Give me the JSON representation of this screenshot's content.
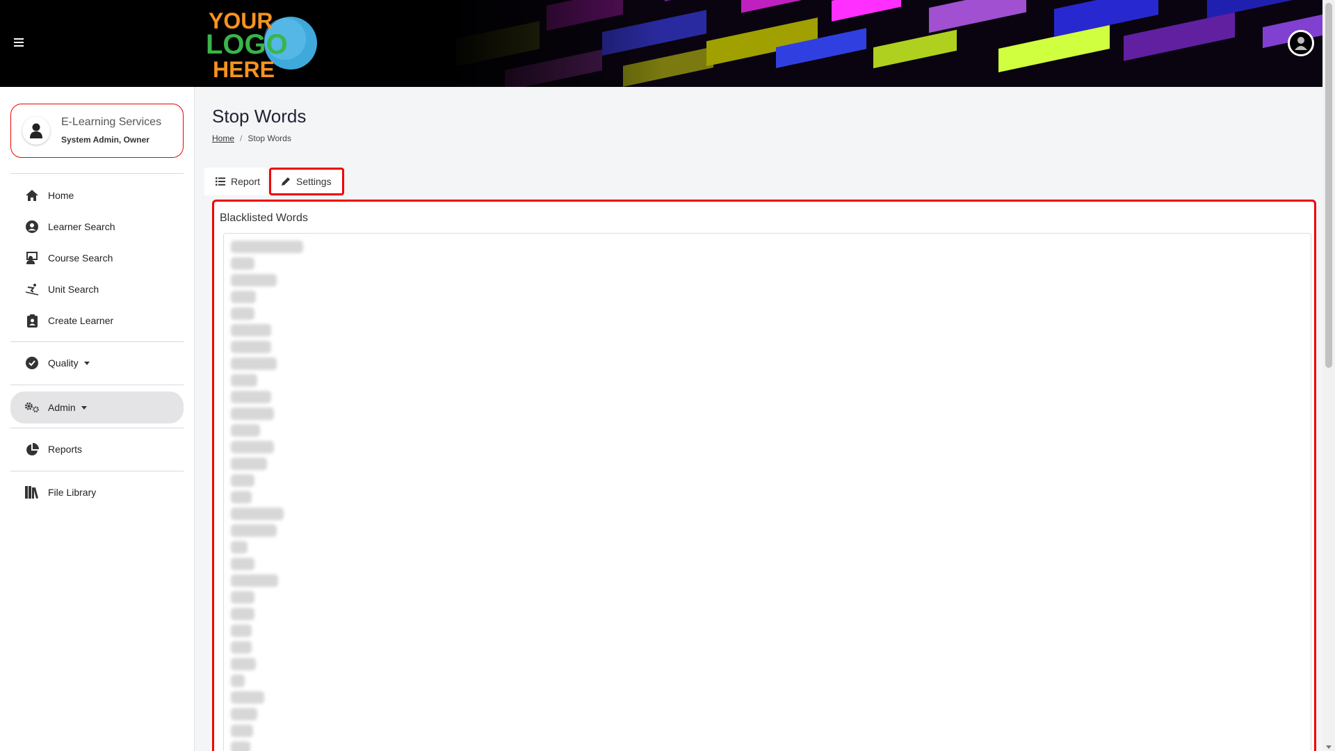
{
  "header": {
    "menu_icon": "hamburger-icon",
    "logo_text": [
      "YOUR",
      "LOGO",
      "HERE"
    ],
    "user_icon": "user-circle-icon"
  },
  "sidebar": {
    "org": {
      "name": "E-Learning Services",
      "role": "System Admin, Owner"
    },
    "items": [
      {
        "label": "Home",
        "icon": "home-icon"
      },
      {
        "label": "Learner Search",
        "icon": "user-circle-icon"
      },
      {
        "label": "Course Search",
        "icon": "teacher-icon"
      },
      {
        "label": "Unit Search",
        "icon": "skiing-icon"
      },
      {
        "label": "Create Learner",
        "icon": "clipboard-user-icon"
      },
      {
        "label": "Quality",
        "icon": "check-circle-icon"
      },
      {
        "label": "Admin",
        "icon": "cogs-icon"
      },
      {
        "label": "Reports",
        "icon": "pie-chart-icon"
      },
      {
        "label": "File Library",
        "icon": "books-icon"
      }
    ]
  },
  "page": {
    "title": "Stop Words",
    "breadcrumb": {
      "home": "Home",
      "sep": "/",
      "current": "Stop Words"
    }
  },
  "tabs": [
    {
      "label": "Report",
      "icon": "list-icon"
    },
    {
      "label": "Settings",
      "icon": "pencil-icon"
    }
  ],
  "panel": {
    "title": "Blacklisted Words"
  },
  "colors": {
    "highlight": "#ee0000",
    "header_bg": "#000000",
    "active_nav": "#e4e4e7"
  }
}
